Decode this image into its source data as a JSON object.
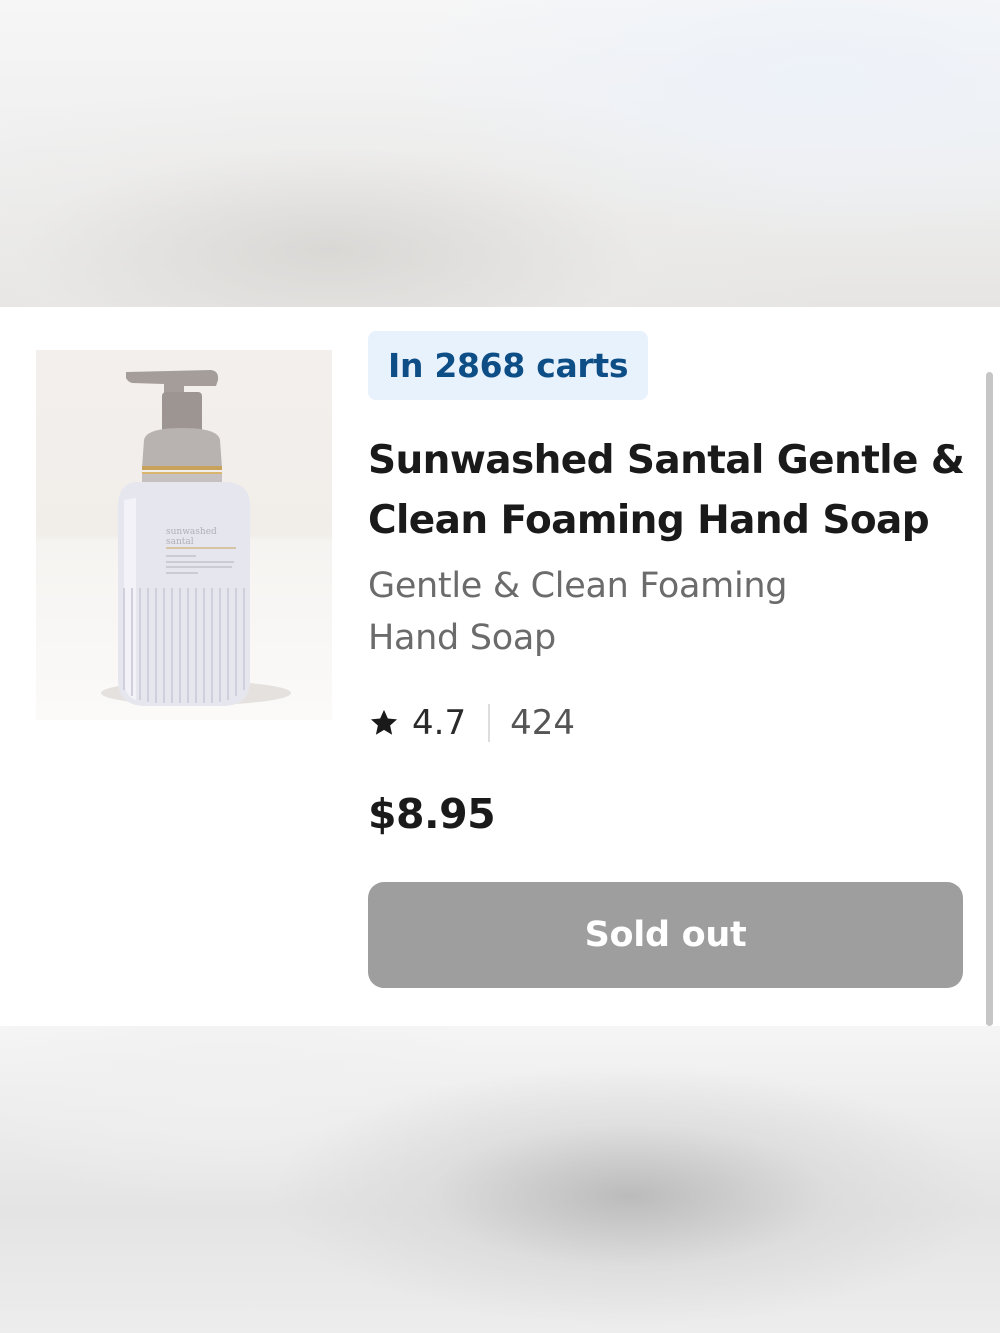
{
  "product": {
    "cart_badge": "In 2868 carts",
    "title": "Sunwashed Santal Gentle & Clean Foaming Hand Soap",
    "subtitle": "Gentle & Clean Foaming Hand Soap",
    "rating": "4.7",
    "review_count": "424",
    "price": "$8.95",
    "button_label": "Sold out",
    "image_label_line1": "sunwashed",
    "image_label_line2": "santal"
  },
  "icons": {
    "rating_star": "star-icon"
  },
  "colors": {
    "badge_bg": "#e8f2fc",
    "badge_text": "#0e4e86",
    "button_disabled": "#9e9e9e"
  }
}
